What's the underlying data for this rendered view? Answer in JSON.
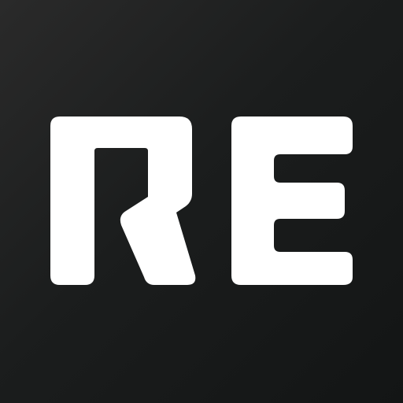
{
  "logo": {
    "text": "RE",
    "foreground_color": "#ffffff",
    "background_color_top_left": "#2a2a2a",
    "background_color_bottom_right": "#131515"
  }
}
